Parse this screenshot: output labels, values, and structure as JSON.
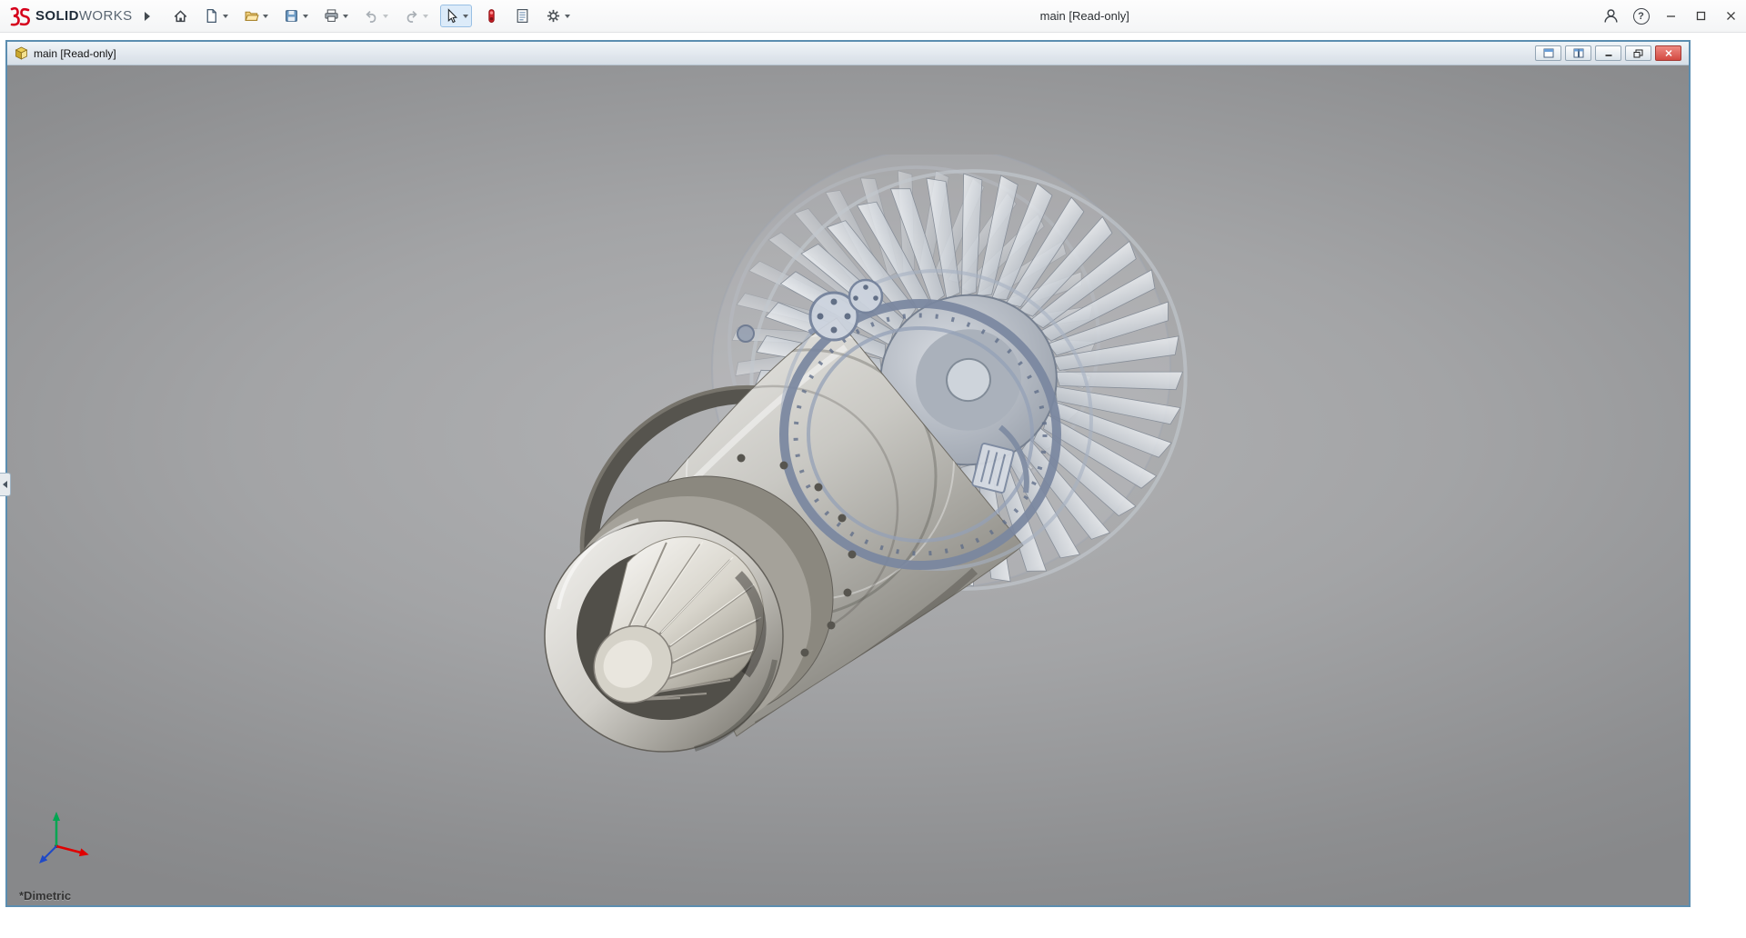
{
  "titlebar": {
    "brand_bold": "SOLID",
    "brand_light": "WORKS",
    "title": "main [Read-only]",
    "help_glyph": "?"
  },
  "toolbar": {
    "buttons": [
      {
        "icon": "home",
        "dropdown": false,
        "disabled": false,
        "active": false
      },
      {
        "icon": "new-document",
        "dropdown": true,
        "disabled": false,
        "active": false
      },
      {
        "icon": "open",
        "dropdown": true,
        "disabled": false,
        "active": false
      },
      {
        "icon": "save",
        "dropdown": true,
        "disabled": false,
        "active": false
      },
      {
        "icon": "print",
        "dropdown": true,
        "disabled": false,
        "active": false
      },
      {
        "icon": "undo",
        "dropdown": true,
        "disabled": true,
        "active": false
      },
      {
        "icon": "redo",
        "dropdown": true,
        "disabled": true,
        "active": false
      },
      {
        "icon": "select",
        "dropdown": true,
        "disabled": false,
        "active": true
      },
      {
        "icon": "rebuild",
        "dropdown": false,
        "disabled": false,
        "active": false
      },
      {
        "icon": "file-properties",
        "dropdown": false,
        "disabled": false,
        "active": false
      },
      {
        "icon": "options",
        "dropdown": true,
        "disabled": false,
        "active": false
      }
    ]
  },
  "window_controls": [
    "user-account",
    "help",
    "minimize",
    "maximize",
    "close"
  ],
  "document_window": {
    "title": "main [Read-only]",
    "controls": [
      "new-window",
      "tile-window",
      "minimize",
      "restore",
      "close"
    ]
  },
  "viewport": {
    "view_orientation": "*Dimetric",
    "model": "jet-engine-assembly-3d-model",
    "background_top": "#8f9092",
    "background_mid": "#aaabad",
    "background_bottom": "#87888a",
    "triad_axes": {
      "x": "#e00000",
      "y": "#00a651",
      "z": "#1f49c7"
    }
  },
  "colors": {
    "doc_border": "#5b8db0",
    "close_button": "#d34a42",
    "logo_red": "#d6001c",
    "active_tool_bg": "#dcebf9"
  }
}
